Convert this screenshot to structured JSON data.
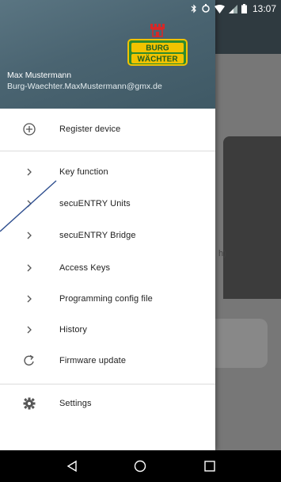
{
  "status_bar": {
    "time": "13:07",
    "icons": [
      "bluetooth-icon",
      "sync-icon",
      "wifi-icon",
      "signal-icon",
      "battery-icon"
    ]
  },
  "drawer": {
    "header": {
      "logo_text_line1": "BURG",
      "logo_text_line2": "WÄCHTER",
      "user_name": "Max Mustermann",
      "user_email": "Burg-Waechter.MaxMustermann@gmx.de",
      "background_color": "#4a6471"
    },
    "items": [
      {
        "icon": "add-circle-icon",
        "label": "Register device"
      },
      {
        "icon": "chevron-right-icon",
        "label": "Key function"
      },
      {
        "icon": "chevron-right-icon",
        "label": "secuENTRY Units"
      },
      {
        "icon": "chevron-right-icon",
        "label": "secuENTRY Bridge"
      },
      {
        "icon": "chevron-right-icon",
        "label": "Access Keys"
      },
      {
        "icon": "chevron-right-icon",
        "label": "Programming config file"
      },
      {
        "icon": "chevron-right-icon",
        "label": "History"
      },
      {
        "icon": "refresh-icon",
        "label": "Firmware update"
      },
      {
        "icon": "gear-icon",
        "label": "Settings"
      }
    ]
  },
  "background_screen": {
    "partial_text": "h)"
  },
  "nav_bar": {
    "buttons": [
      "back-icon",
      "home-icon",
      "recents-icon"
    ]
  },
  "colors": {
    "logo_green": "#2e8b2e",
    "logo_yellow": "#f2c300",
    "logo_red": "#d62828",
    "annotation": "#2f4f8f"
  }
}
